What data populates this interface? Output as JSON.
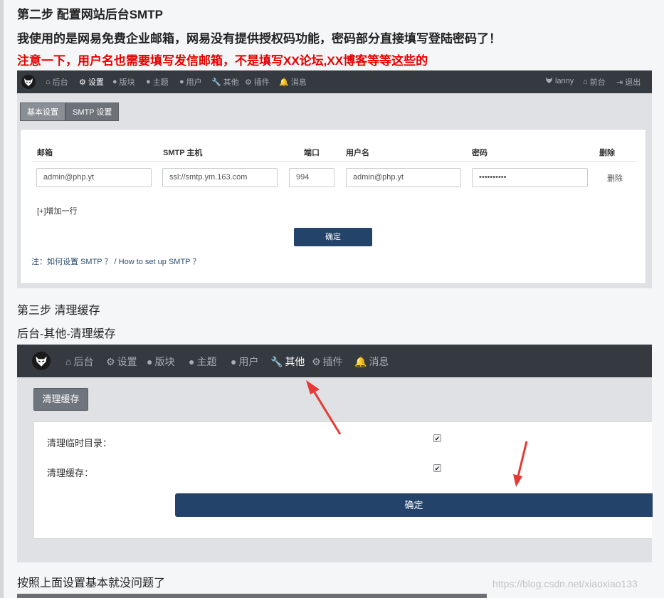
{
  "article": {
    "step2_heading": "第二步 配置网站后台SMTP",
    "note_email": "我使用的是网易免费企业邮箱，网易没有提供授权码功能，密码部分直接填写登陆密码了！",
    "note_warning": "注意一下，用户名也需要填写发信邮箱，不是填写XX论坛,XX博客等等这些的",
    "step3_heading": "第三步 清理缓存",
    "step3_path": "后台-其他-清理缓存",
    "final_note": "按照上面设置基本就没问题了",
    "watermark": "https://blog.csdn.net/xiaoxiao133"
  },
  "nav": {
    "items": [
      {
        "icon": "home-icon",
        "glyph": "⌂",
        "label": "后台"
      },
      {
        "icon": "gear-icon",
        "glyph": "⚙",
        "label": "设置"
      },
      {
        "icon": "comment-icon",
        "glyph": "●",
        "label": "版块"
      },
      {
        "icon": "comment-icon",
        "glyph": "●",
        "label": "主题"
      },
      {
        "icon": "user-icon",
        "glyph": "●",
        "label": "用户"
      },
      {
        "icon": "wrench-icon",
        "glyph": "🔧",
        "label": "其他"
      },
      {
        "icon": "gears-icon",
        "glyph": "⚙",
        "label": "插件"
      },
      {
        "icon": "bell-icon",
        "glyph": "🔔",
        "label": "消息"
      }
    ],
    "right": {
      "username": "lanny",
      "frontend_label": "前台",
      "logout_label": "退出"
    }
  },
  "smtp_page": {
    "tabs": [
      "基本设置",
      "SMTP 设置"
    ],
    "columns": {
      "email": "邮箱",
      "host": "SMTP 主机",
      "port": "端口",
      "username": "用户名",
      "password": "密码",
      "delete": "删除"
    },
    "row": {
      "email": "admin@php.yt",
      "host": "ssl://smtp.ym.163.com",
      "port": "994",
      "username": "admin@php.yt",
      "password": "••••••••••",
      "delete": "删除"
    },
    "add_row": "[+]增加一行",
    "submit": "确定",
    "note": "注：如何设置 SMTP ？ / How to set up SMTP ？"
  },
  "cache_page": {
    "button": "清理缓存",
    "options": [
      {
        "label": "清理临时目录：",
        "checked": true
      },
      {
        "label": "清理缓存：",
        "checked": true
      }
    ],
    "submit": "确定"
  },
  "colors": {
    "nav_bg": "#353a40",
    "primary_button": "#24436b",
    "warning_text": "#e60000",
    "annotation_arrow": "#e53935"
  }
}
